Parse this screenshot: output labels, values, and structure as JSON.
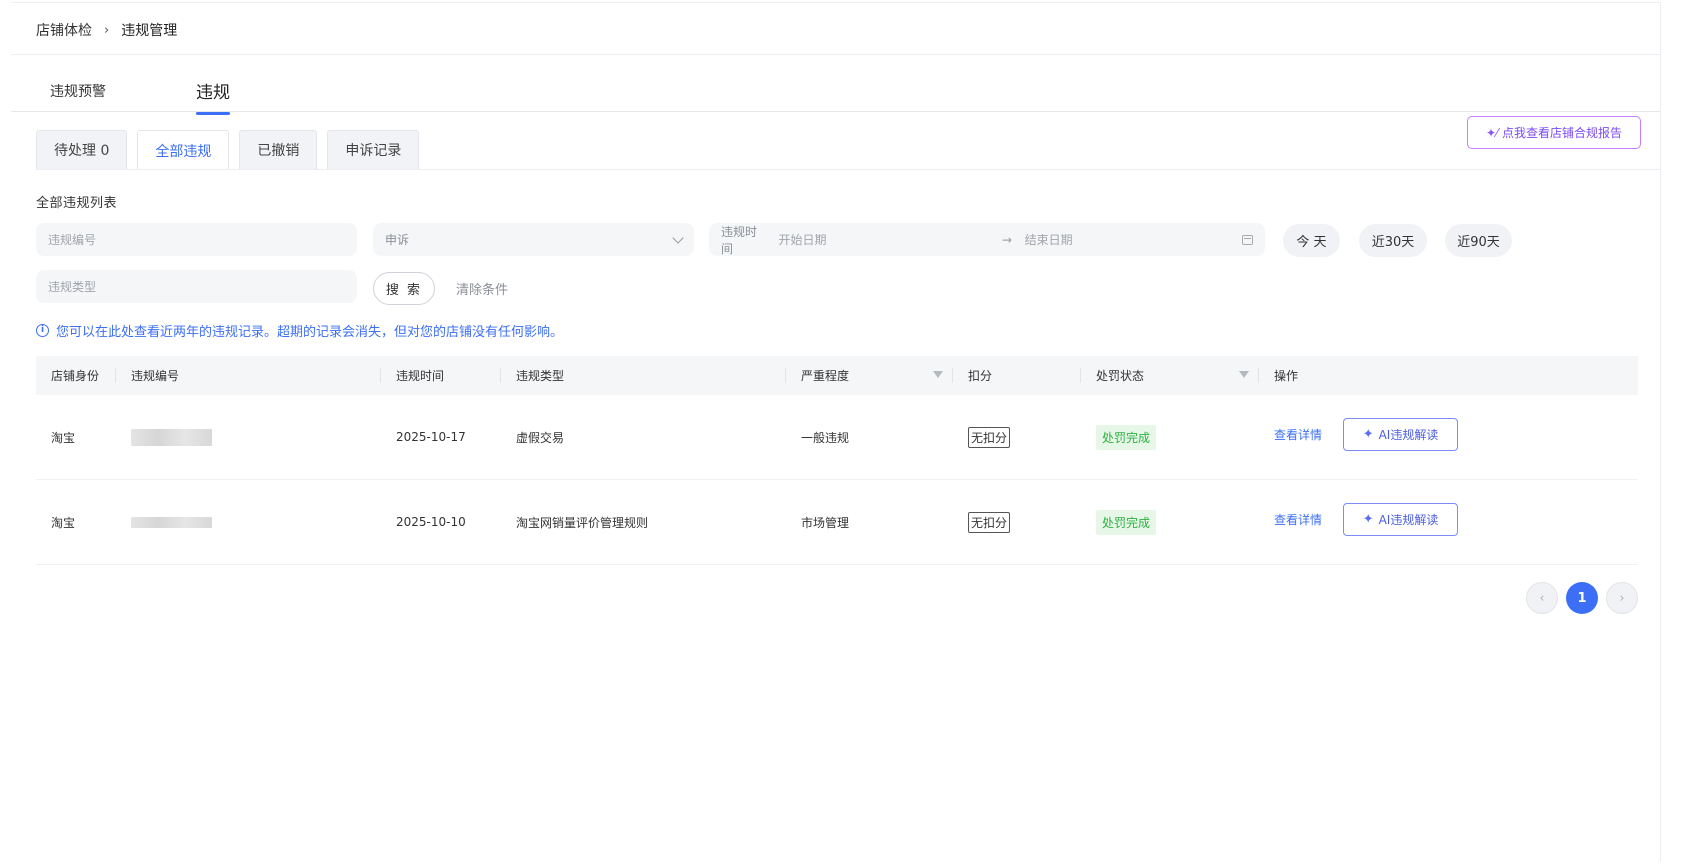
{
  "breadcrumb": {
    "parent": "店铺体检",
    "current": "违规管理"
  },
  "main_tabs": [
    {
      "label": "违规预警",
      "active": false
    },
    {
      "label": "违规",
      "active": true
    }
  ],
  "report_button": {
    "label": "点我查看店铺合规报告"
  },
  "sub_tabs": [
    {
      "label": "待处理 0",
      "active": false
    },
    {
      "label": "全部违规",
      "active": true
    },
    {
      "label": "已撤销",
      "active": false
    },
    {
      "label": "申诉记录",
      "active": false
    }
  ],
  "section_title": "全部违规列表",
  "filters": {
    "violation_no_placeholder": "违规编号",
    "appeal_select_value": "申诉",
    "time_label": "违规时间",
    "start_placeholder": "开始日期",
    "end_placeholder": "结束日期",
    "range_arrow": "→",
    "violation_type_placeholder": "违规类型",
    "quick_today": "今 天",
    "quick_30": "近30天",
    "quick_90": "近90天",
    "search_label": "搜 索",
    "clear_label": "清除条件"
  },
  "notice": {
    "icon": "i",
    "text": "您可以在此处查看近两年的违规记录。超期的记录会消失，但对您的店铺没有任何影响。"
  },
  "table": {
    "headers": {
      "shop": "店铺身份",
      "no": "违规编号",
      "time": "违规时间",
      "type": "违规类型",
      "severity": "严重程度",
      "points": "扣分",
      "status": "处罚状态",
      "action": "操作"
    },
    "rows": [
      {
        "shop": "淘宝",
        "time": "2025-10-17",
        "type": "虚假交易",
        "severity": "一般违规",
        "points": "无扣分",
        "status": "处罚完成",
        "detail": "查看详情",
        "ai": "AI违规解读"
      },
      {
        "shop": "淘宝",
        "time": "2025-10-10",
        "type": "淘宝网销量评价管理规则",
        "severity": "市场管理",
        "points": "无扣分",
        "status": "处罚完成",
        "detail": "查看详情",
        "ai": "AI违规解读"
      }
    ]
  },
  "pagination": {
    "prev": "‹",
    "current": "1",
    "next": "›"
  }
}
